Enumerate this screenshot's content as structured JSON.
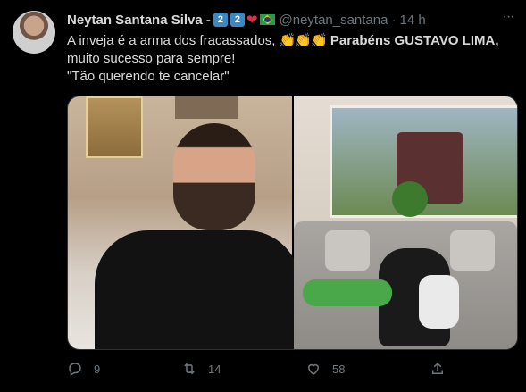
{
  "tweet": {
    "author": {
      "name": "Neytan Santana Silva -",
      "badges": [
        "2",
        "2"
      ],
      "handle": "@neytan_santana",
      "separator": "·",
      "time": "14 h"
    },
    "text": {
      "line1_pre": "A inveja é a arma dos fracassados,",
      "claps": "👏👏👏",
      "line1_bold": "Parabéns GUSTAVO LIMA,",
      "line2": "muito sucesso para sempre!",
      "line3": "\"Tão querendo te cancelar\""
    },
    "actions": {
      "reply_count": "9",
      "retweet_count": "14",
      "like_count": "58"
    },
    "colors": {
      "background": "#000000",
      "text": "#d9d9d9",
      "muted": "#6e767d",
      "keycap": "#3b88c3",
      "heart": "#dd2e44"
    },
    "icons": [
      "more-icon",
      "reply-icon",
      "retweet-icon",
      "like-icon",
      "share-icon"
    ]
  }
}
